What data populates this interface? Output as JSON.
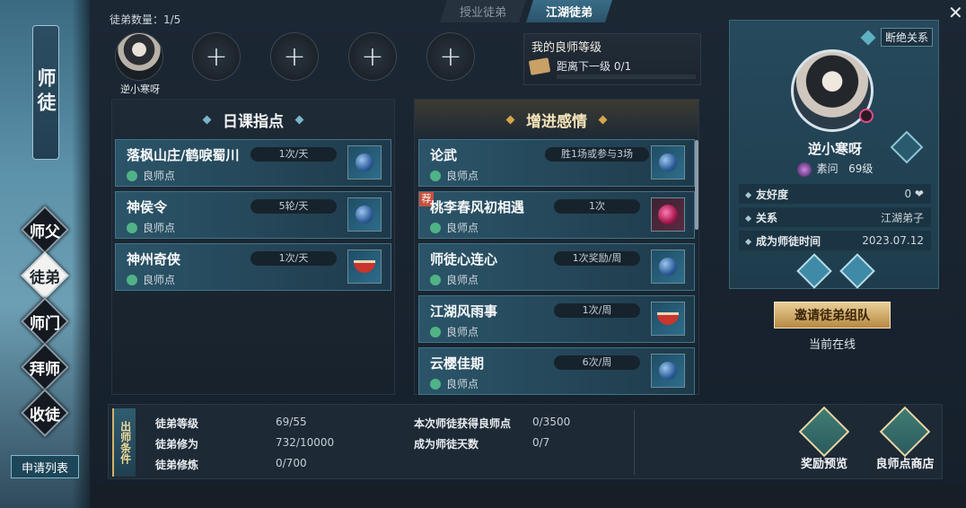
{
  "sidebar": {
    "title": "师徒",
    "nav": [
      "师父",
      "徒弟",
      "师门",
      "拜师",
      "收徒"
    ],
    "active": "徒弟",
    "apply_list": "申请列表"
  },
  "tabs": [
    "授业徒弟",
    "江湖徒弟"
  ],
  "active_tab": "江湖徒弟",
  "disciple_count": "徒弟数量：1/5",
  "disciple_slot_name": "逆小寒呀",
  "add_slot_symbol": "+",
  "master_level": {
    "title": "我的良师等级",
    "progress_text": "距离下一级 0/1",
    "progress": 0
  },
  "daily": {
    "title": "日课指点",
    "items": [
      {
        "name": "落枫山庄/鹤唳蜀川",
        "freq": "1次/天",
        "reward_label": "良师点",
        "reward_icon": "gem-icon"
      },
      {
        "name": "神侯令",
        "freq": "5轮/天",
        "reward_label": "良师点",
        "reward_icon": "gem-icon"
      },
      {
        "name": "神州奇侠",
        "freq": "1次/天",
        "reward_label": "良师点",
        "reward_icon": "food-bowl-icon"
      }
    ]
  },
  "affection": {
    "title": "增进感情",
    "tag": "荐",
    "items": [
      {
        "name": "论武",
        "freq": "胜1场或参与3场",
        "reward_label": "良师点",
        "reward_icon": "gem-icon"
      },
      {
        "name": "桃李春风初相遇",
        "freq": "1次",
        "reward_label": "良师点",
        "reward_icon": "pink-orb-icon"
      },
      {
        "name": "师徒心连心",
        "freq": "1次奖励/周",
        "reward_label": "良师点",
        "reward_icon": "gem-icon"
      },
      {
        "name": "江湖风雨事",
        "freq": "1次/周",
        "reward_label": "良师点",
        "reward_icon": "food-bowl-icon"
      },
      {
        "name": "云樱佳期",
        "freq": "6次/周",
        "reward_label": "良师点",
        "reward_icon": "gem-icon"
      }
    ]
  },
  "profile": {
    "break_label": "断绝关系",
    "name": "逆小寒呀",
    "sect": "素问",
    "level": "69级",
    "rows": [
      {
        "label": "友好度",
        "value": "0 ❤"
      },
      {
        "label": "关系",
        "value": "江湖弟子"
      },
      {
        "label": "成为师徒时间",
        "value": "2023.07.12"
      }
    ],
    "invite": "邀请徒弟组队",
    "status": "当前在线"
  },
  "graduation": {
    "tag": "出师条件",
    "conditions": [
      {
        "label": "徒弟等级",
        "value": "69/55"
      },
      {
        "label": "徒弟修为",
        "value": "732/10000"
      },
      {
        "label": "徒弟修炼",
        "value": "0/700"
      },
      {
        "label": "本次师徒获得良师点",
        "value": "0/3500"
      },
      {
        "label": "成为师徒天数",
        "value": "0/7"
      }
    ]
  },
  "actions": {
    "reward_preview": "奖励预览",
    "shop": "良师点商店"
  },
  "close_symbol": "✕",
  "colors": {
    "accent": "#3f7489",
    "gold": "#d6a64b"
  }
}
